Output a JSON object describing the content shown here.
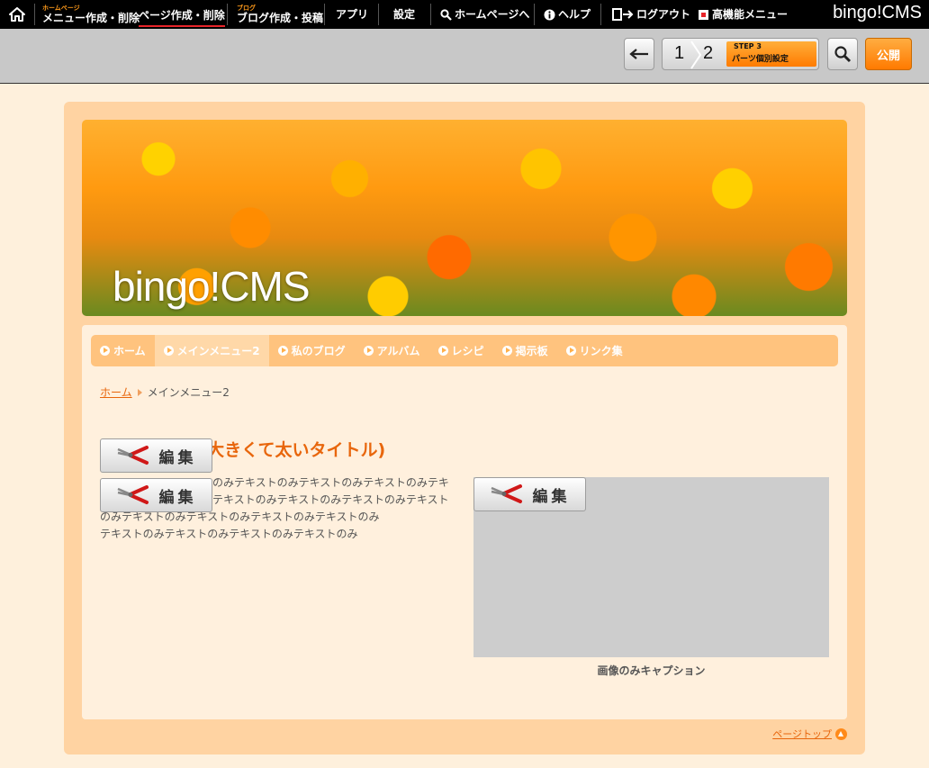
{
  "topbar": {
    "home_icon": "home-icon",
    "menu_edit": {
      "small": "ホームページ",
      "label": "メニュー作成・削除"
    },
    "page_edit": {
      "label": "ページ作成・削除"
    },
    "blog": {
      "small": "ブログ",
      "label": "ブログ作成・投稿"
    },
    "apps": "アプリ",
    "settings": "設定",
    "to_homepage": "ホームページへ",
    "help": "ヘルプ",
    "logout": "ログアウト",
    "advanced_menu": "高機能メニュー",
    "brand": "bingo!CMS"
  },
  "toolbar": {
    "back_icon": "arrow-left-icon",
    "step1": "1",
    "step2": "2",
    "step3_small": "STEP 3",
    "step3_label": "パーツ個別設定",
    "search_icon": "magnifier-icon",
    "publish": "公開"
  },
  "site": {
    "banner_title": "bingo!CMS",
    "nav": [
      "ホーム",
      "メインメニュー2",
      "私のブログ",
      "アルバム",
      "レシピ",
      "掲示板",
      "リンク集"
    ],
    "nav_current_index": 1,
    "breadcrumb": {
      "home": "ホーム",
      "current": "メインメニュー2"
    },
    "heading": "出し - 大きくて太いタイトル)",
    "body_lines": [
      "のみテキストのみテキストのみテキストのみテキ",
      "テキストのみテキストのみテキストのみテキスト",
      "のみテキストのみテキストのみテキストのみテキストのみ",
      "テキストのみテキストのみテキストのみテキストのみ"
    ],
    "caption": "画像のみキャプション",
    "edit_label": "編集",
    "page_top": "ページトップ"
  },
  "colors": {
    "accent": "#ff8a00",
    "link": "#e8660c",
    "nav_bg": "#ffc37e",
    "site_bg": "#ffd3a2",
    "content_bg": "#fff0dd"
  }
}
